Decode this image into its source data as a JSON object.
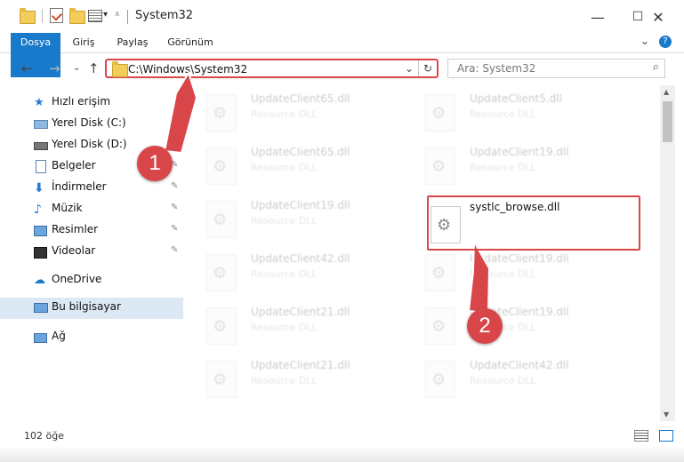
{
  "window": {
    "title": "System32",
    "min_glyph": "—",
    "max_glyph": "☐",
    "close_glyph": "✕",
    "help_glyph": "?",
    "expand_glyph": "⌄"
  },
  "ribbon": {
    "tabs": [
      "Dosya",
      "Giriş",
      "Paylaş",
      "Görünüm"
    ]
  },
  "nav": {
    "back": "←",
    "forward": "→",
    "recent": "⌄",
    "up": "↑"
  },
  "address": {
    "path": "C:\\Windows\\System32",
    "chevron": "⌄",
    "refresh": "↻"
  },
  "search": {
    "placeholder": "Ara: System32",
    "icon": "⌕"
  },
  "sidebar": {
    "items": [
      {
        "label": "Hızlı erişim",
        "icon": "star-icon",
        "pinned": false
      },
      {
        "label": "Yerel Disk (C:)",
        "icon": "drive-icon",
        "pinned": true
      },
      {
        "label": "Yerel Disk (D:)",
        "icon": "drive-icon",
        "pinned": true
      },
      {
        "label": "Belgeler",
        "icon": "documents-icon",
        "pinned": true
      },
      {
        "label": "İndirmeler",
        "icon": "download-icon",
        "pinned": true
      },
      {
        "label": "Müzik",
        "icon": "music-icon",
        "pinned": true
      },
      {
        "label": "Resimler",
        "icon": "pictures-icon",
        "pinned": true
      },
      {
        "label": "Videolar",
        "icon": "videos-icon",
        "pinned": true
      },
      {
        "label": "OneDrive",
        "icon": "cloud-icon",
        "pinned": false
      },
      {
        "label": "Bu bilgisayar",
        "icon": "computer-icon",
        "pinned": false,
        "selected": true
      },
      {
        "label": "Ağ",
        "icon": "network-icon",
        "pinned": false
      }
    ],
    "pin_glyph": "📌"
  },
  "files": {
    "left": [
      {
        "name": "UpdateClient65.dll",
        "type": "Resource DLL"
      },
      {
        "name": "UpdateClient65.dll",
        "type": "Resource DLL"
      },
      {
        "name": "UpdateClient19.dll",
        "type": "Resource DLL"
      },
      {
        "name": "UpdateClient42.dll",
        "type": "Resource DLL"
      },
      {
        "name": "UpdateClient21.dll",
        "type": "Resource DLL"
      },
      {
        "name": "UpdateClient21.dll",
        "type": "Resource DLL"
      }
    ],
    "right": [
      {
        "name": "UpdateClient5.dll",
        "type": "Resource DLL"
      },
      {
        "name": "UpdateClient19.dll",
        "type": "Resource DLL"
      },
      {
        "name": "systlc_browse.dll",
        "type": "",
        "highlighted": true
      },
      {
        "name": "UpdateClient19.dll",
        "type": "Resource DLL"
      },
      {
        "name": "UpdateClient19.dll",
        "type": "Resource DLL"
      },
      {
        "name": "UpdateClient42.dll",
        "type": "Resource DLL"
      }
    ]
  },
  "status": {
    "count": "102 öğe"
  },
  "annotations": {
    "badge1": "1",
    "badge2": "2",
    "color": "#d9464a"
  }
}
